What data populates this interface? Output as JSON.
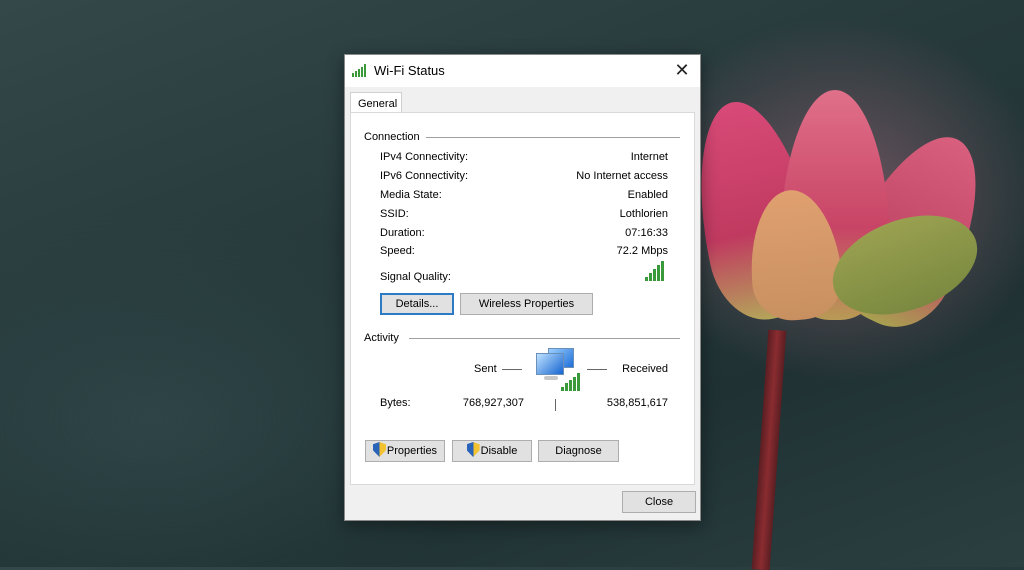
{
  "window": {
    "title": "Wi-Fi Status",
    "close_glyph": "✕"
  },
  "tab": "General",
  "connection": {
    "heading": "Connection",
    "rows": [
      {
        "label": "IPv4 Connectivity:",
        "value": "Internet"
      },
      {
        "label": "IPv6 Connectivity:",
        "value": "No Internet access"
      },
      {
        "label": "Media State:",
        "value": "Enabled"
      },
      {
        "label": "SSID:",
        "value": "Lothlorien"
      },
      {
        "label": "Duration:",
        "value": "07:16:33"
      },
      {
        "label": "Speed:",
        "value": "72.2 Mbps"
      }
    ],
    "signal_label": "Signal Quality:",
    "signal_bars": 5,
    "signal_max": 5
  },
  "buttons": {
    "details": "Details...",
    "wireless": "Wireless Properties",
    "properties": "Properties",
    "disable": "Disable",
    "diagnose": "Diagnose",
    "close": "Close"
  },
  "activity": {
    "heading": "Activity",
    "sent_label": "Sent",
    "received_label": "Received",
    "bytes_label": "Bytes:",
    "sent": "768,927,307",
    "received": "538,851,617"
  },
  "colors": {
    "signal": "#3a9a3a",
    "default_button": "#2d7bc4"
  }
}
